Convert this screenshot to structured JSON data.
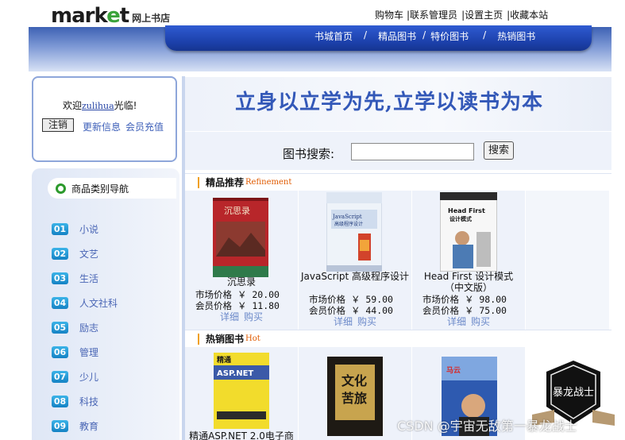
{
  "logo": {
    "word_prefix": "mark",
    "word_e": "e",
    "word_suffix": "t",
    "sub": "网上书店"
  },
  "top_links": [
    "购物车",
    "|联系管理员",
    "|设置主页",
    "|收藏本站"
  ],
  "nav": {
    "items": [
      "书城首页",
      "精品图书",
      "特价图书",
      "热销图书"
    ],
    "separator": "/"
  },
  "welcome": {
    "prefix": "欢迎",
    "username": "zulihua",
    "suffix": "光临!",
    "logout": "注销",
    "update_link": "更新信息",
    "recharge_link": "会员充值"
  },
  "categories": {
    "title": "商品类别导航",
    "items": [
      {
        "num": "01",
        "label": "小说"
      },
      {
        "num": "02",
        "label": "文艺"
      },
      {
        "num": "03",
        "label": "生活"
      },
      {
        "num": "04",
        "label": "人文社科"
      },
      {
        "num": "05",
        "label": "励志"
      },
      {
        "num": "06",
        "label": "管理"
      },
      {
        "num": "07",
        "label": "少儿"
      },
      {
        "num": "08",
        "label": "科技"
      },
      {
        "num": "09",
        "label": "教育"
      }
    ]
  },
  "slogan": "立身以立学为先,立学以读书为本",
  "search": {
    "label": "图书搜索:",
    "value": "",
    "button": "搜索"
  },
  "featured": {
    "title": "精品推荐",
    "subtitle": "Refinement",
    "books": [
      {
        "name": "沉思录",
        "market_label": "市场价格",
        "market_price": "￥ 20.00",
        "member_label": "会员价格",
        "member_price": "￥ 11.80",
        "detail": "详细",
        "buy": "购买"
      },
      {
        "name": "JavaScript 高级程序设计",
        "market_label": "市场价格",
        "market_price": "￥ 59.00",
        "member_label": "会员价格",
        "member_price": "￥ 44.00",
        "detail": "详细",
        "buy": "购买"
      },
      {
        "name": "Head First 设计模式（中文版）",
        "market_label": "市场价格",
        "market_price": "￥ 98.00",
        "member_label": "会员价格",
        "member_price": "￥ 75.00",
        "detail": "详细",
        "buy": "购买"
      }
    ]
  },
  "hot": {
    "title": "热销图书",
    "subtitle": "Hot",
    "books": [
      {
        "name": "精通ASP.NET 2.0电子商"
      }
    ]
  },
  "badge": {
    "text": "暴龙战士"
  },
  "watermark": "CSDN @宇宙无敌第一暴龙战士",
  "colors": {
    "nav_blue": "#1b3fa8",
    "link_blue": "#3d5fb8",
    "accent_green": "#3aa33a",
    "accent_orange": "#f0a020"
  }
}
